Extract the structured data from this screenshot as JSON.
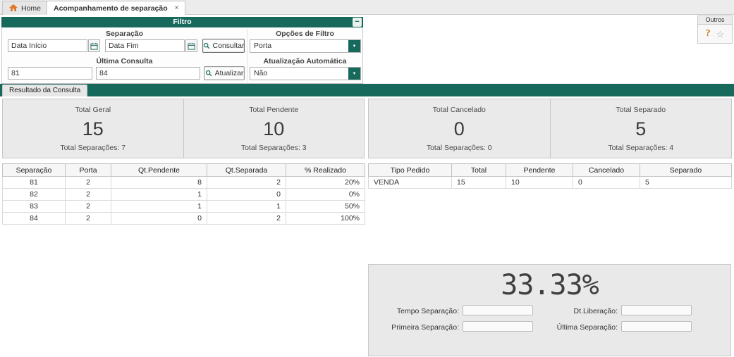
{
  "colors": {
    "accent_teal": "#17695C",
    "panel_gray": "#e9e9e9",
    "help_orange": "#c9731f"
  },
  "icons": {
    "home": "house",
    "calendar": "calendar-grid",
    "search": "magnifier",
    "chevron_down": "▼",
    "close": "×",
    "minimize": "−",
    "help": "?",
    "star": "☆"
  },
  "window": {
    "tabs": [
      {
        "label": "Home"
      },
      {
        "label": "Acompanhamento de separação",
        "close": "×"
      }
    ]
  },
  "filter": {
    "title": "Filtro",
    "minimize_label": "−",
    "separacao": {
      "label": "Separação",
      "data_inicio": "Data Início",
      "data_fim": "Data Fim",
      "consultar": "Consultar"
    },
    "opcoes_filtro": {
      "label": "Opções de Filtro",
      "value": "Porta"
    },
    "ultima_consulta": {
      "label": "Última Consulta",
      "de": "81",
      "ate": "84",
      "atualizar": "Atualizar"
    },
    "atualizacao_automatica": {
      "label": "Atualização Automática",
      "value": "Não"
    }
  },
  "outros": {
    "title": "Outros",
    "help": "?",
    "star": "☆"
  },
  "result_tab": {
    "label": "Resultado da Consulta"
  },
  "summary": {
    "cards": [
      {
        "title": "Total Geral",
        "value": "15",
        "subtitle": "Total Separações: 7"
      },
      {
        "title": "Total Pendente",
        "value": "10",
        "subtitle": "Total Separações: 3"
      },
      {
        "title": "Total Cancelado",
        "value": "0",
        "subtitle": "Total Separações: 0"
      },
      {
        "title": "Total Separado",
        "value": "5",
        "subtitle": "Total Separações: 4"
      }
    ]
  },
  "separacoes_table": {
    "columns": [
      "Separação",
      "Porta",
      "Qt.Pendente",
      "Qt.Separada",
      "% Realizado"
    ],
    "rows": [
      [
        "81",
        "2",
        "8",
        "2",
        "20%"
      ],
      [
        "82",
        "2",
        "1",
        "0",
        "0%"
      ],
      [
        "83",
        "2",
        "1",
        "1",
        "50%"
      ],
      [
        "84",
        "2",
        "0",
        "2",
        "100%"
      ]
    ]
  },
  "tipos_table": {
    "columns": [
      "Tipo Pedido",
      "Total",
      "Pendente",
      "Cancelado",
      "Separado"
    ],
    "rows": [
      [
        "VENDA",
        "15",
        "10",
        "0",
        "5"
      ]
    ]
  },
  "detail": {
    "percent": "33.33%",
    "tempo_separacao_label": "Tempo Separação:",
    "dt_liberacao_label": "Dt.Liberação:",
    "primeira_separacao_label": "Primeira Separação:",
    "ultima_separacao_label": "Última Separação:"
  }
}
